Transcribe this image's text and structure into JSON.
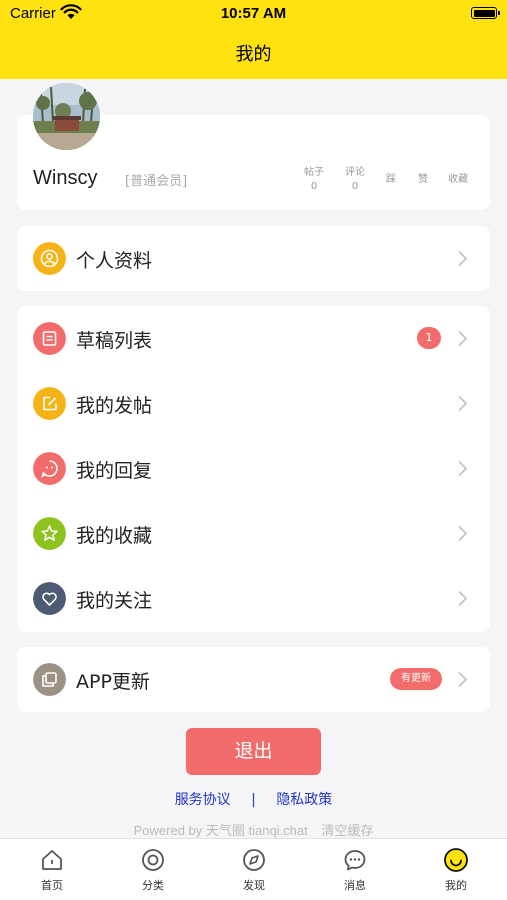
{
  "status_bar": {
    "carrier": "Carrier",
    "time": "10:57 AM"
  },
  "nav": {
    "title": "我的"
  },
  "profile": {
    "username": "Winscy",
    "member_level": "[普通会员]",
    "stats": [
      {
        "label": "帖子",
        "value": "0"
      },
      {
        "label": "评论",
        "value": "0"
      },
      {
        "label": "踩",
        "value": ""
      },
      {
        "label": "赞",
        "value": ""
      },
      {
        "label": "收藏",
        "value": ""
      }
    ]
  },
  "menu": {
    "profile_item": {
      "label": "个人资料",
      "icon": "user-circle-icon",
      "color": "#f6b315"
    },
    "content_items": [
      {
        "label": "草稿列表",
        "icon": "document-icon",
        "color": "#f36c6c",
        "badge": "1"
      },
      {
        "label": "我的发帖",
        "icon": "edit-icon",
        "color": "#f6b315"
      },
      {
        "label": "我的回复",
        "icon": "chat-face-icon",
        "color": "#f36c6c"
      },
      {
        "label": "我的收藏",
        "icon": "star-icon",
        "color": "#8ec21f"
      },
      {
        "label": "我的关注",
        "icon": "heart-icon",
        "color": "#4d5a73"
      }
    ],
    "update_item": {
      "label": "APP更新",
      "icon": "copy-icon",
      "color": "#9a9385",
      "badge": "有更新"
    }
  },
  "logout_label": "退出",
  "footer": {
    "terms": "服务协议",
    "separator": "|",
    "privacy": "隐私政策",
    "powered": "Powered by 天气圈 tianqi.chat",
    "clear_cache": "清空缓存"
  },
  "tabbar": [
    {
      "label": "首页",
      "icon": "home-icon"
    },
    {
      "label": "分类",
      "icon": "category-icon"
    },
    {
      "label": "发现",
      "icon": "compass-icon"
    },
    {
      "label": "消息",
      "icon": "message-icon"
    },
    {
      "label": "我的",
      "icon": "smile-icon",
      "active": true
    }
  ],
  "colors": {
    "header_bg": "#ffe20f",
    "accent_red": "#f36c6c",
    "link_blue": "#1f36c9"
  }
}
